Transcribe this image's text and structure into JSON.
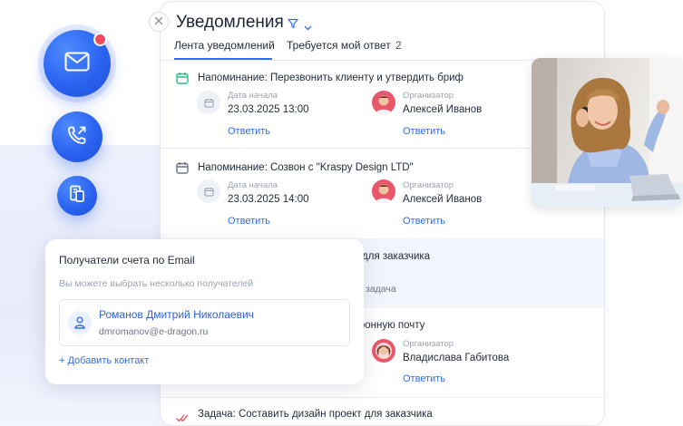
{
  "panel": {
    "title": "Уведомления",
    "tabs": [
      {
        "label": "Лента уведомлений",
        "active": true
      },
      {
        "label": "Требуется мой ответ",
        "count": "2"
      }
    ]
  },
  "notifications": [
    {
      "title": "Напоминание: Перезвонить клиенту и утвердить бриф",
      "start_label": "Дата начала",
      "start_value": "23.03.2025 13:00",
      "organizer_label": "Организатор",
      "organizer_name": "Алексей Иванов",
      "reply_left": "Ответить",
      "reply_right": "Ответить",
      "icon_color": "#2bbf8a"
    },
    {
      "title": "Напоминание: Созвон с \"Kraspy Design LTD\"",
      "start_label": "Дата начала",
      "start_value": "23.03.2025 14:00",
      "organizer_label": "Организатор",
      "organizer_name": "Алексей Иванов",
      "reply_left": "Ответить",
      "reply_right": "Ответить"
    },
    {
      "title_tail": "ект для заказчика",
      "sub_tail": "задача"
    },
    {
      "title_tail": "ектронную почту",
      "organizer_label": "Организатор",
      "organizer_name": "Владислава Габитова",
      "reply": "Ответить"
    },
    {
      "title": "Задача: Составить дизайн проект для заказчика"
    }
  ],
  "popup": {
    "title": "Получатели счета по Email",
    "hint": "Вы можете выбрать несколько получателей",
    "contact_name": "Романов Дмитрий Николаевич",
    "contact_email": "dmromanov@e-dragon.ru",
    "add_contact": "+ Добавить контакт"
  },
  "colors": {
    "accent": "#2f6cf0",
    "badge": "#f04a5d",
    "task_check": "#e8505b"
  }
}
